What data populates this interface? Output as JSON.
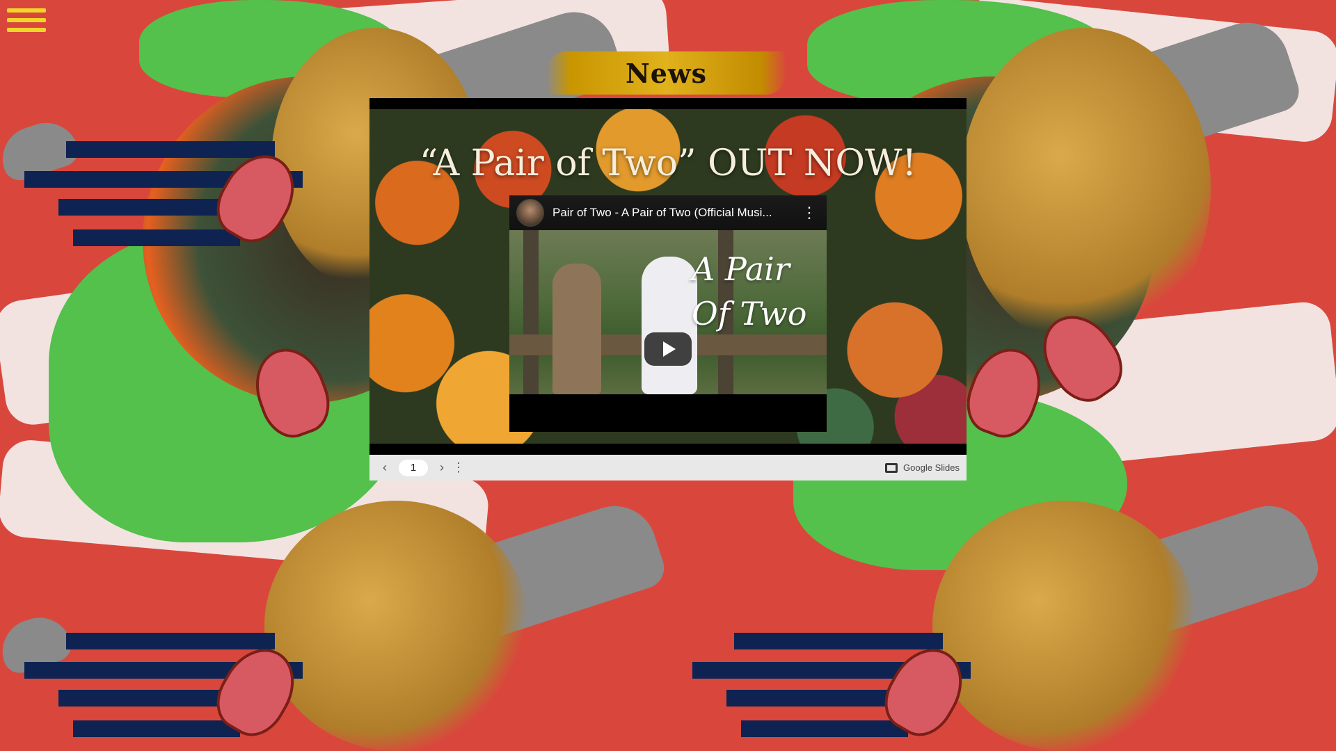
{
  "header": {
    "menu_icon": "hamburger-menu-icon",
    "page_title": "News"
  },
  "slides": {
    "heading": "“A Pair of Two” OUT NOW!",
    "video": {
      "title": "Pair of Two - A Pair of Two (Official Musi...",
      "thumbnail_text": "A Pair Of Two",
      "more_icon": "more-vert-icon",
      "play_icon": "play-icon"
    },
    "toolbar": {
      "prev_icon": "chevron-left-icon",
      "page_number": "1",
      "next_icon": "chevron-right-icon",
      "options_icon": "more-vert-icon",
      "brand_label": "Google Slides",
      "brand_icon": "slides-icon"
    }
  },
  "colors": {
    "background": "#d9473c",
    "menu": "#f2d52b",
    "banner": "#d4a114",
    "green": "#53c14b",
    "navy": "#0f2352"
  }
}
